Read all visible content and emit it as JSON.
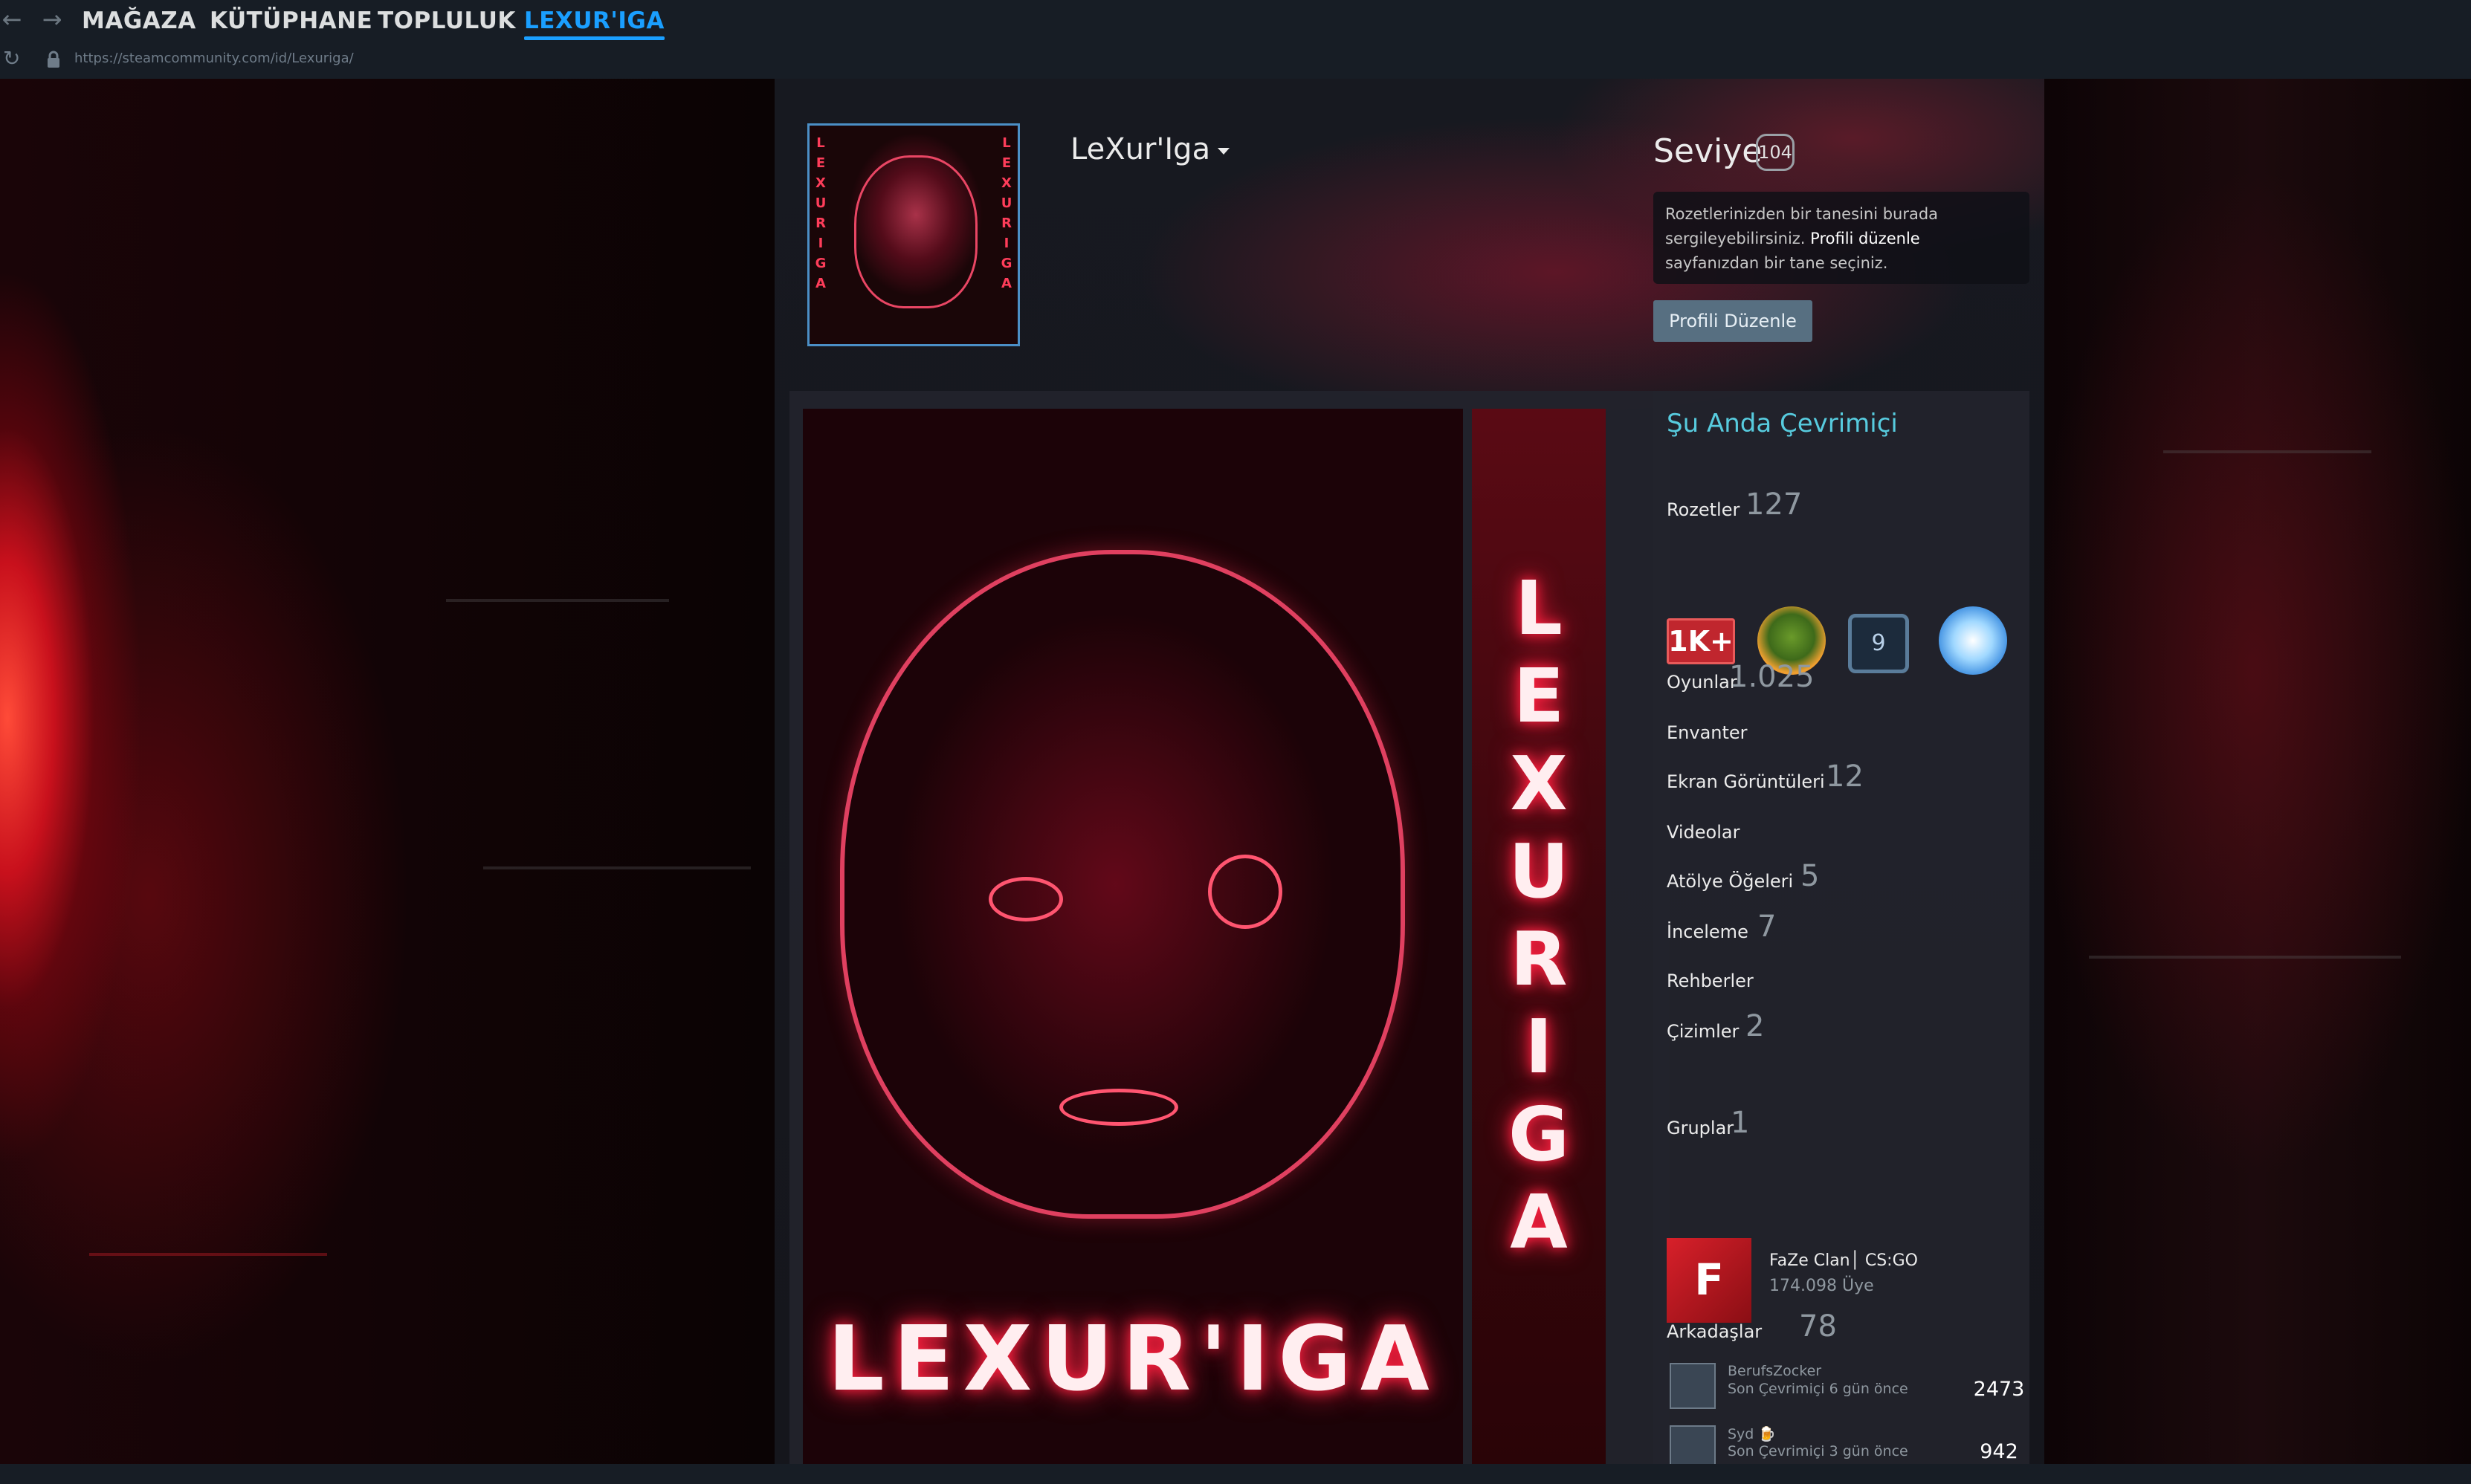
{
  "nav": {
    "back_icon": "arrow-left",
    "forward_icon": "arrow-right",
    "tabs": [
      {
        "label": "MAĞAZA"
      },
      {
        "label": "KÜTÜPHANE"
      },
      {
        "label": "TOPLULUK"
      },
      {
        "label": "LEXUR'IGA"
      }
    ],
    "active_tab": "LEXUR'IGA",
    "url": "https://steamcommunity.com/id/Lexuriga/"
  },
  "profile": {
    "name": "LeXur'Iga",
    "level_label": "Seviye",
    "level": "104",
    "badge_note_part1": "Rozetlerinizden bir tanesini burada sergileyebilirsiniz.",
    "badge_note_link": "Profili düzenle",
    "badge_note_part2": "sayfanızdan bir tane seçiniz.",
    "edit_button": "Profili Düzenle",
    "showcase_title": "LEXUR'IGA",
    "showcase_side_letters": [
      "L",
      "E",
      "X",
      "U",
      "R",
      "I",
      "G",
      "A"
    ]
  },
  "sidebar": {
    "status": "Şu Anda Çevrimiçi",
    "badges_label": "Rozetler",
    "badges_count": "127",
    "badge_items": [
      {
        "name": "1k-badge",
        "text": "1K+"
      },
      {
        "name": "tree-badge",
        "text": ""
      },
      {
        "name": "years-badge",
        "text": "9"
      },
      {
        "name": "snowflake-badge",
        "text": ""
      }
    ],
    "stats": [
      {
        "label": "Oyunlar",
        "count": "1.025"
      },
      {
        "label": "Envanter",
        "count": ""
      },
      {
        "label": "Ekran Görüntüleri",
        "count": "12"
      },
      {
        "label": "Videolar",
        "count": ""
      },
      {
        "label": "Atölye Öğeleri",
        "count": "5"
      },
      {
        "label": "İnceleme",
        "count": "7"
      },
      {
        "label": "Rehberler",
        "count": ""
      },
      {
        "label": "Çizimler",
        "count": "2"
      }
    ],
    "groups_label": "Gruplar",
    "groups_count": "1",
    "group": {
      "name": "FaZe Clan│ CS:GO",
      "members": "174.098 Üye"
    },
    "friends_label": "Arkadaşlar",
    "friends_count": "78",
    "friends": [
      {
        "name": "BerufsZocker",
        "status": "Son Çevrimiçi 6 gün önce",
        "level": "2473"
      },
      {
        "name": "Syd 🍺",
        "status": "Son Çevrimiçi 3 gün önce",
        "level": "942"
      }
    ]
  },
  "colors": {
    "accent": "#1a9fff",
    "online": "#57cbde",
    "button": "#576f81"
  }
}
